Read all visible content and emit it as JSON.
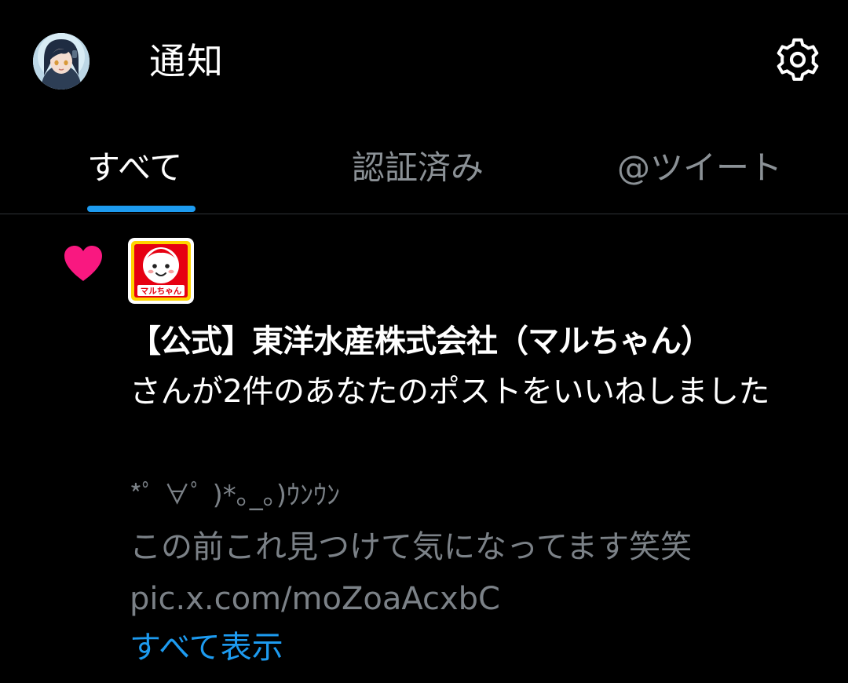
{
  "header": {
    "title": "通知",
    "avatar_icon": "user-avatar",
    "settings_icon": "gear-icon"
  },
  "tabs": [
    {
      "label": "すべて",
      "active": true
    },
    {
      "label": "認証済み",
      "active": false
    },
    {
      "label": "@ツイート",
      "active": false
    }
  ],
  "notification": {
    "type_icon": "heart-icon",
    "actor_logo_text": "マルちゃん",
    "actor_name": "【公式】東洋水産株式会社（マルちゃん）",
    "action_text": "さんが2件のあなたのポストをいいねしました",
    "post_lines": [
      "*ﾟ ∀ﾟ )*｡_｡)ｳﾝｳﾝ",
      "この前これ見つけて気になってます笑笑",
      "pic.x.com/moZoaAcxbC"
    ],
    "show_all_label": "すべて表示"
  },
  "colors": {
    "background": "#000000",
    "accent": "#1d9bf0",
    "like": "#f91880",
    "muted_text": "#7b8187",
    "divider": "#2f3336",
    "logo_red": "#e60012",
    "logo_yellow": "#ffd400"
  }
}
